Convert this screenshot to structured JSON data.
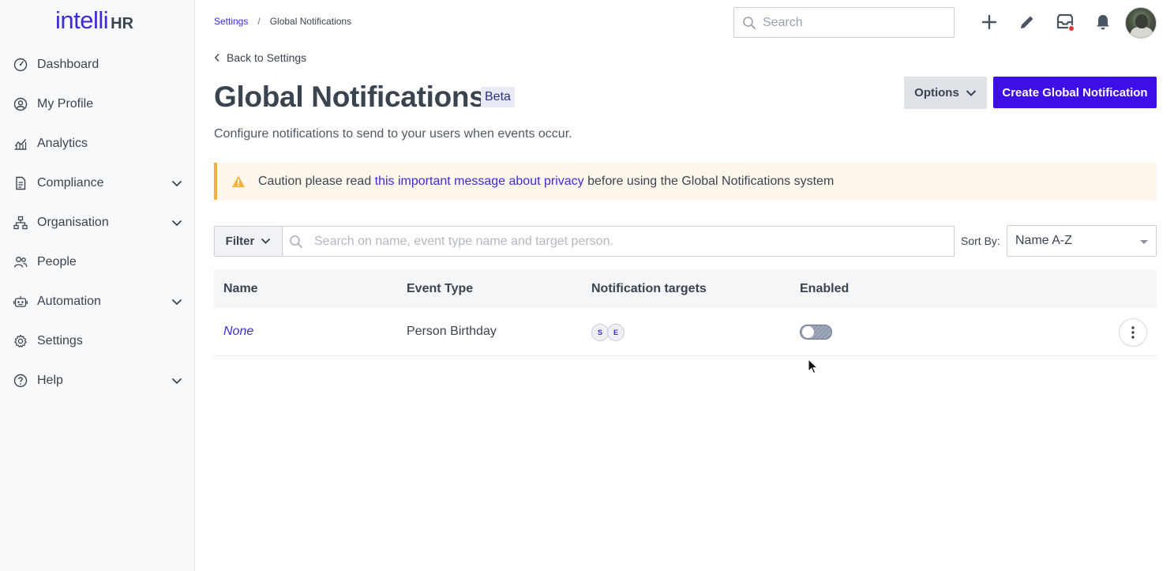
{
  "app": {
    "logo_text": "intelli",
    "logo_suffix": "HR",
    "accent_color": "#3d0ee8",
    "link_color": "#3d2bd6"
  },
  "sidebar": {
    "items": [
      {
        "label": "Dashboard",
        "icon": "dashboard-icon",
        "expandable": false
      },
      {
        "label": "My Profile",
        "icon": "profile-icon",
        "expandable": false
      },
      {
        "label": "Analytics",
        "icon": "analytics-icon",
        "expandable": false
      },
      {
        "label": "Compliance",
        "icon": "compliance-icon",
        "expandable": true
      },
      {
        "label": "Organisation",
        "icon": "organisation-icon",
        "expandable": true
      },
      {
        "label": "People",
        "icon": "people-icon",
        "expandable": false
      },
      {
        "label": "Automation",
        "icon": "automation-icon",
        "expandable": true
      },
      {
        "label": "Settings",
        "icon": "settings-icon",
        "expandable": false
      },
      {
        "label": "Help",
        "icon": "help-icon",
        "expandable": true
      }
    ]
  },
  "header": {
    "breadcrumb": [
      "Settings",
      "Global Notifications"
    ],
    "breadcrumb_sep": "/",
    "search_placeholder": "Search",
    "icons": [
      "plus-icon",
      "pencil-icon",
      "inbox-icon",
      "bell-icon"
    ]
  },
  "page": {
    "back_label": "Back to Settings",
    "title": "Global Notifications",
    "badge": "Beta",
    "options_label": "Options",
    "create_label": "Create Global Notification",
    "subtitle": "Configure notifications to send to your users when events occur."
  },
  "caution": {
    "prefix": "Caution please read ",
    "link": "this important message about privacy",
    "suffix": " before using the Global Notifications system",
    "color": "#f0b23a"
  },
  "filters": {
    "filter_label": "Filter",
    "search_placeholder": "Search on name, event type name and target person.",
    "sort_label": "Sort By:",
    "sort_value": "Name A-Z"
  },
  "table": {
    "columns": [
      "Name",
      "Event Type",
      "Notification targets",
      "Enabled"
    ],
    "rows": [
      {
        "name": "None",
        "event_type": "Person Birthday",
        "targets": [
          "S",
          "E"
        ],
        "enabled": false
      }
    ]
  }
}
